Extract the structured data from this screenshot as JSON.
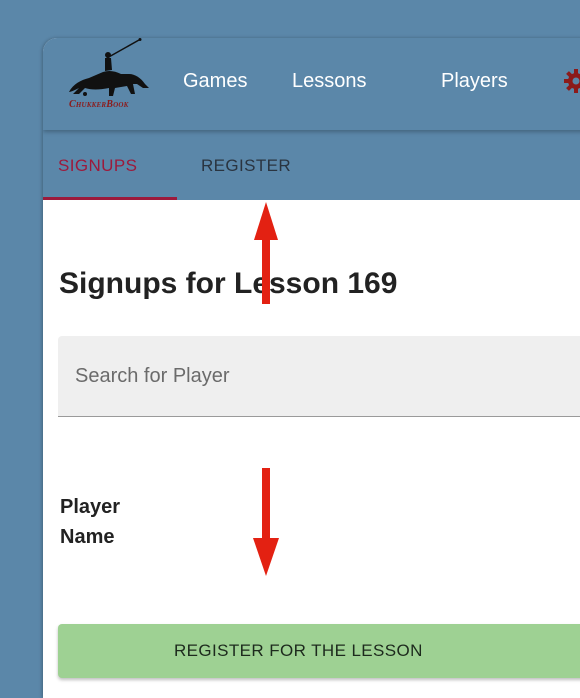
{
  "brand": {
    "logo_text": "ChukkerBook"
  },
  "navbar": {
    "links": [
      "Games",
      "Lessons",
      "Players"
    ],
    "settings_icon": "gear-icon"
  },
  "tabs": [
    {
      "label": "SIGNUPS",
      "active": true
    },
    {
      "label": "REGISTER",
      "active": false
    }
  ],
  "main": {
    "title": "Signups for Lesson 169",
    "search_placeholder": "Search for Player",
    "column_header": "Player Name",
    "register_button_label": "REGISTER FOR THE LESSON"
  },
  "colors": {
    "background": "#5b87a9",
    "active_tab": "#9c1a3c",
    "register_button": "#9ed193",
    "logo_red": "#8c1a1a",
    "annotation_arrow": "#e32112"
  }
}
